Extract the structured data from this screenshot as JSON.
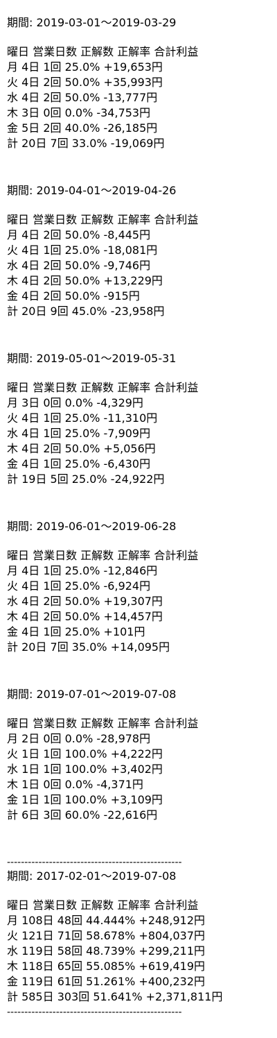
{
  "sections": [
    {
      "period": "期間: 2019-03-01～2019-03-29",
      "header": "曜日 営業日数 正解数 正解率 合計利益",
      "rows": [
        "月 4日 1回 25.0% +19,653円",
        "火 4日 2回 50.0% +35,993円",
        "水 4日 2回 50.0% -13,777円",
        "木 3日 0回 0.0% -34,753円",
        "金 5日 2回 40.0% -26,185円",
        "計 20日 7回 33.0% -19,069円"
      ]
    },
    {
      "period": "期間: 2019-04-01～2019-04-26",
      "header": "曜日 営業日数 正解数 正解率 合計利益",
      "rows": [
        "月 4日 2回 50.0% -8,445円",
        "火 4日 1回 25.0% -18,081円",
        "水 4日 2回 50.0% -9,746円",
        "木 4日 2回 50.0% +13,229円",
        "金 4日 2回 50.0% -915円",
        "計 20日 9回 45.0% -23,958円"
      ]
    },
    {
      "period": "期間: 2019-05-01～2019-05-31",
      "header": "曜日 営業日数 正解数 正解率 合計利益",
      "rows": [
        "月 3日 0回 0.0% -4,329円",
        "火 4日 1回 25.0% -11,310円",
        "水 4日 1回 25.0% -7,909円",
        "木 4日 2回 50.0% +5,056円",
        "金 4日 1回 25.0% -6,430円",
        "計 19日 5回 25.0% -24,922円"
      ]
    },
    {
      "period": "期間: 2019-06-01～2019-06-28",
      "header": "曜日 営業日数 正解数 正解率 合計利益",
      "rows": [
        "月 4日 1回 25.0% -12,846円",
        "火 4日 1回 25.0% -6,924円",
        "水 4日 2回 50.0% +19,307円",
        "木 4日 2回 50.0% +14,457円",
        "金 4日 1回 25.0% +101円",
        "計 20日 7回 35.0% +14,095円"
      ]
    },
    {
      "period": "期間: 2019-07-01～2019-07-08",
      "header": "曜日 営業日数 正解数 正解率 合計利益",
      "rows": [
        "月 2日 0回 0.0% -28,978円",
        "火 1日 1回 100.0% +4,222円",
        "水 1日 1回 100.0% +3,402円",
        "木 1日 0回 0.0% -4,371円",
        "金 1日 1回 100.0% +3,109円",
        "計 6日 3回 60.0% -22,616円"
      ]
    }
  ],
  "summary": {
    "divider": "--------------------------------------------------",
    "period": "期間: 2017-02-01～2019-07-08",
    "header": "曜日 営業日数 正解数 正解率 合計利益",
    "rows": [
      "月 108日 48回 44.444% +248,912円",
      "火 121日 71回 58.678% +804,037円",
      "水 119日 58回 48.739% +299,211円",
      "木 118日 65回 55.085% +619,419円",
      "金 119日 61回 51.261% +400,232円",
      "計 585日 303回 51.641% +2,371,811円"
    ]
  }
}
